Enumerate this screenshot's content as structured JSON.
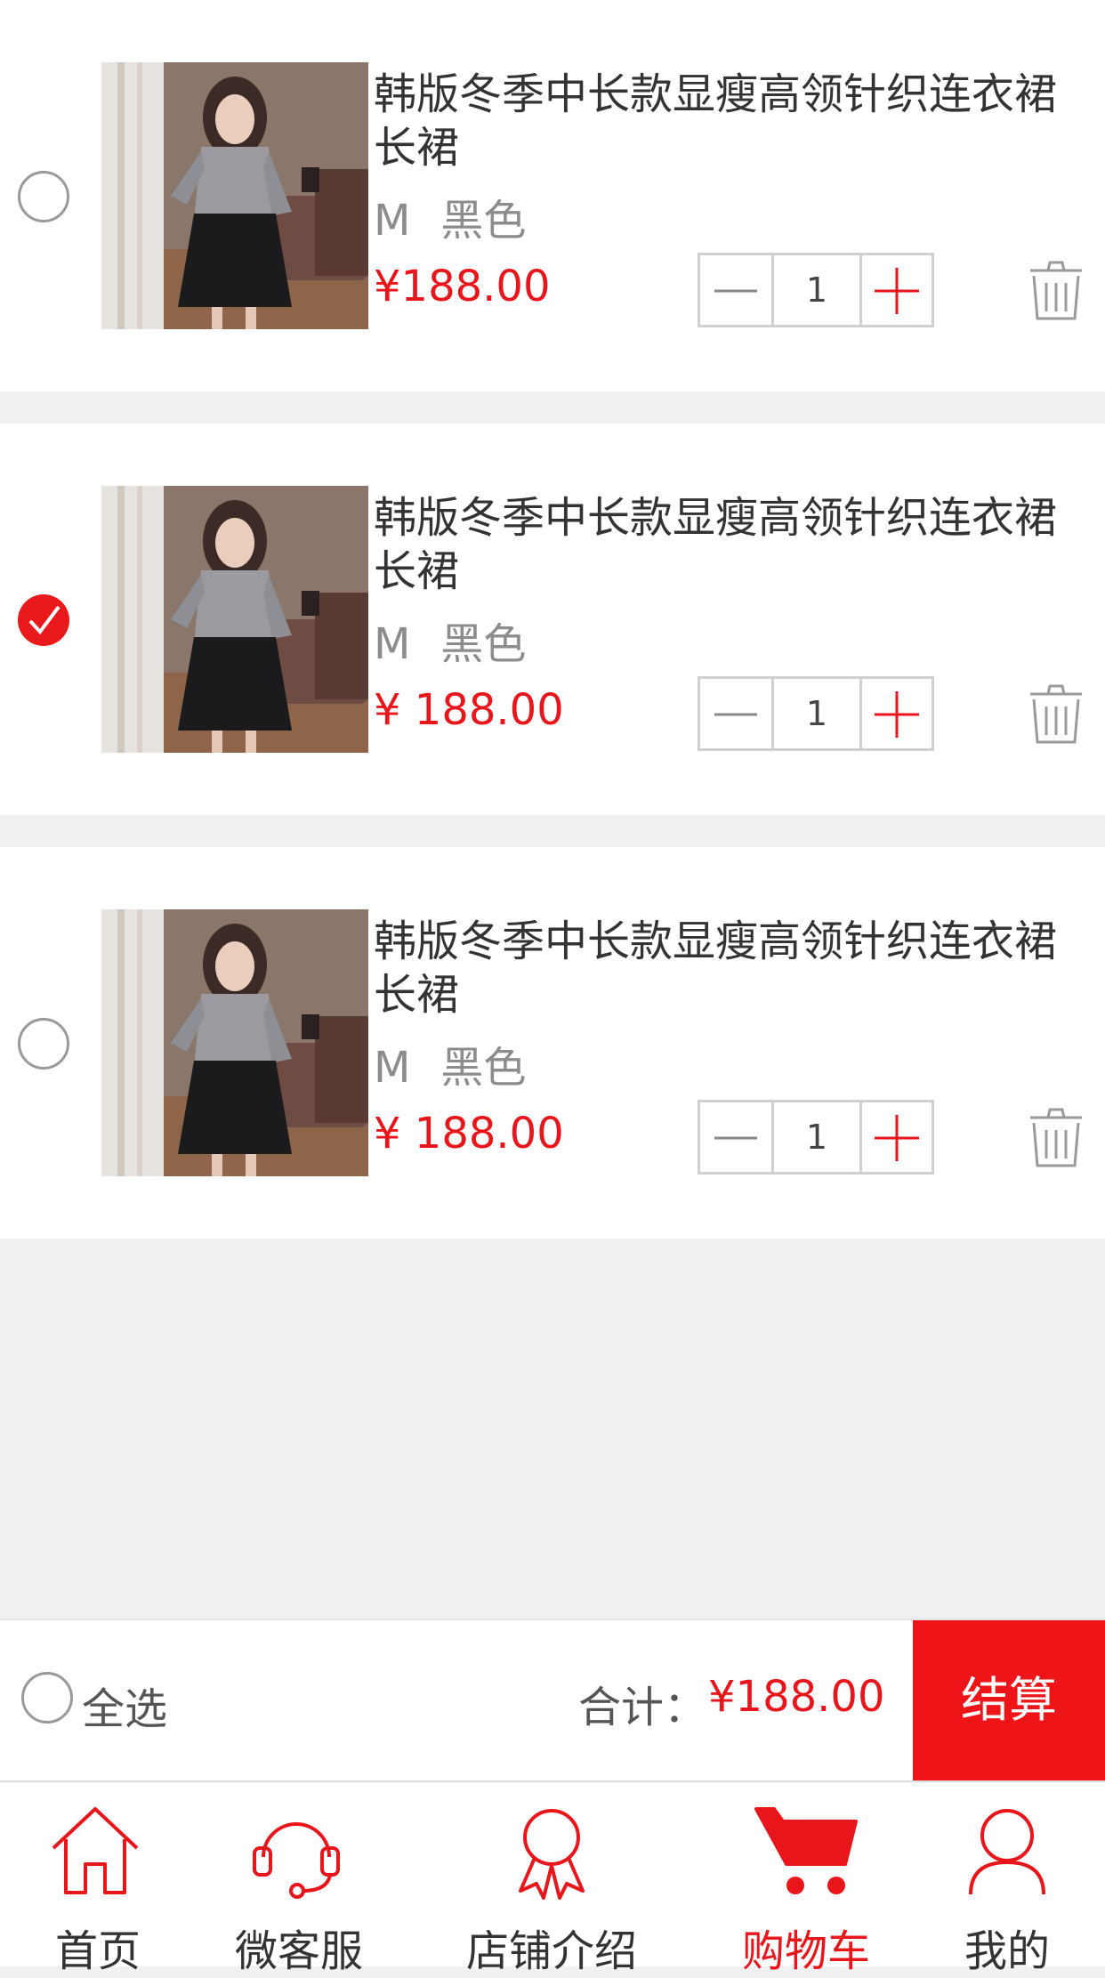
{
  "cart": {
    "items": [
      {
        "title": "韩版冬季中长款显瘦高领针织连衣裙长裙",
        "size": "M",
        "color": "黑色",
        "price": "¥188.00",
        "qty": "1",
        "selected": false
      },
      {
        "title": "韩版冬季中长款显瘦高领针织连衣裙长裙",
        "size": "M",
        "color": "黑色",
        "price": "¥ 188.00",
        "qty": "1",
        "selected": true
      },
      {
        "title": "韩版冬季中长款显瘦高领针织连衣裙长裙",
        "size": "M",
        "color": "黑色",
        "price": "¥ 188.00",
        "qty": "1",
        "selected": false
      }
    ]
  },
  "footer": {
    "select_all": "全选",
    "total_label": "合计：",
    "total_value": "¥188.00",
    "checkout": "结算"
  },
  "tabs": [
    {
      "label": "首页",
      "icon": "home-icon",
      "active": false
    },
    {
      "label": "微客服",
      "icon": "headset-icon",
      "active": false
    },
    {
      "label": "店铺介绍",
      "icon": "ribbon-icon",
      "active": false
    },
    {
      "label": "购物车",
      "icon": "cart-icon",
      "active": true
    },
    {
      "label": "我的",
      "icon": "user-icon",
      "active": false
    }
  ],
  "colors": {
    "accent": "#ee1418",
    "price": "#e8151b",
    "background": "#f1f1f1"
  }
}
